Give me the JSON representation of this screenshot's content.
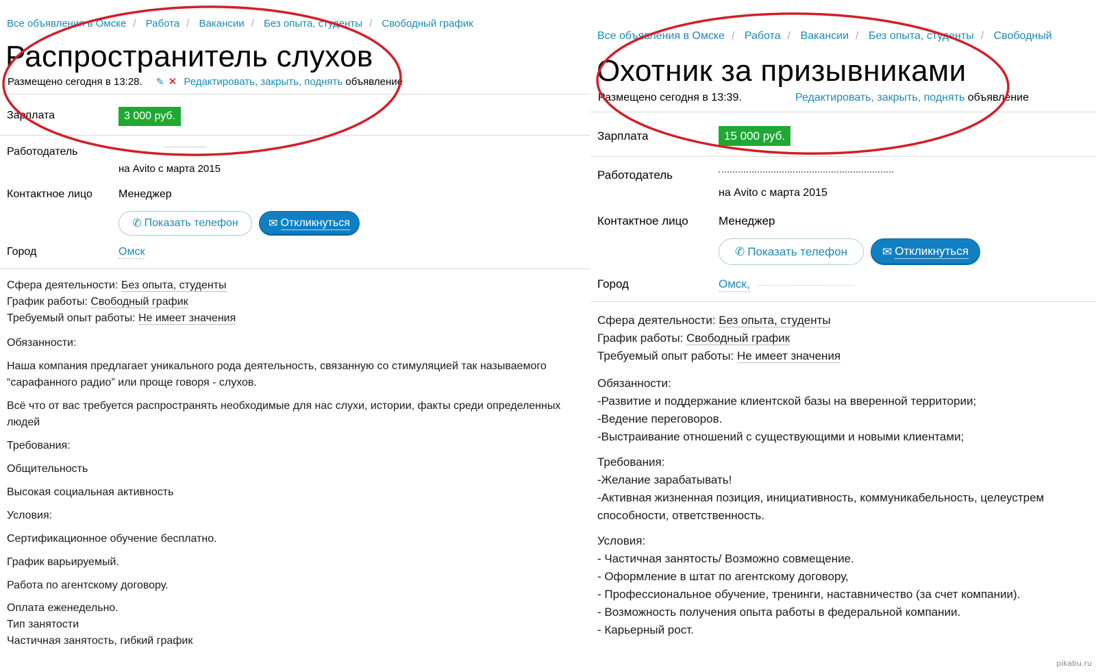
{
  "left": {
    "breadcrumbs": [
      "Все объявления в Омске",
      "Работа",
      "Вакансии",
      "Без опыта, студенты",
      "Свободный график"
    ],
    "title": "Распространитель слухов",
    "posted": "Размещено сегодня в 13:28.",
    "edit_link": "Редактировать, закрыть, поднять",
    "edit_suffix": "объявление",
    "salary_label": "Зарплата",
    "salary": "3 000 руб.",
    "employer_label": "Работодатель",
    "employer_since": "на Avito с марта 2015",
    "contact_label": "Контактное лицо",
    "contact": "Менеджер",
    "phone_button": "Показать телефон",
    "reply_button": "Откликнуться",
    "city_label": "Город",
    "city": "Омск",
    "sphere_label": "Сфера деятельности:",
    "sphere": "Без опыта, студенты",
    "schedule_label": "График работы:",
    "schedule": "Свободный график",
    "experience_label": "Требуемый опыт работы:",
    "experience": "Не имеет значения",
    "description": [
      "Обязанности:",
      "Наша компания предлагает уникального рода деятельность, связанную со стимуляцией так называемого",
      "“сарафанного радио” или проще говоря - слухов.",
      "Всё что от вас требуется распространять необходимые для нас слухи, истории, факты среди определенных",
      "людей",
      "Требования:",
      "Общительность",
      "Высокая социальная активность",
      "Условия:",
      "Сертификационное обучение бесплатно.",
      "График варьируемый.",
      "Работа по агентскому договору.",
      "Оплата еженедельно.",
      "Тип занятости",
      "Частичная занятость, гибкий график"
    ]
  },
  "right": {
    "breadcrumbs": [
      "Все объявления в Омске",
      "Работа",
      "Вакансии",
      "Без опыта, студенты",
      "Свободный"
    ],
    "title": "Охотник за призывниками",
    "posted": "Размещено сегодня в 13:39.",
    "edit_link": "Редактировать, закрыть, поднять",
    "edit_suffix": "объявление",
    "salary_label": "Зарплата",
    "salary": "15 000 руб.",
    "employer_label": "Работодатель",
    "employer_since": "на Avito с марта 2015",
    "contact_label": "Контактное лицо",
    "contact": "Менеджер",
    "phone_button": "Показать телефон",
    "reply_button": "Откликнуться",
    "city_label": "Город",
    "city": "Омск,",
    "sphere_label": "Сфера деятельности:",
    "sphere": "Без опыта, студенты",
    "schedule_label": "График работы:",
    "schedule": "Свободный график",
    "experience_label": "Требуемый опыт работы:",
    "experience": "Не имеет значения",
    "description": [
      "Обязанности:",
      "-Развитие и поддержание клиентской базы на вверенной территории;",
      "-Ведение переговоров.",
      "-Выстраивание отношений с существующими и новыми клиентами;",
      "Требования:",
      "-Желание зарабатывать!",
      "-Активная жизненная позиция, инициативность, коммуникабельность, целеустрем",
      "способности, ответственность.",
      "Условия:",
      "- Частичная занятость/ Возможно совмещение.",
      "- Оформление в штат по агентскому договору,",
      "- Профессиональное обучение, тренинги, наставничество (за счет компании).",
      "- Возможность получения опыта работы в федеральной компании.",
      "- Карьерный рост."
    ]
  },
  "watermark": "pikabu.ru",
  "colors": {
    "link": "#1b8ab3",
    "salary_bg": "#20a834",
    "reply_bg": "#117fc2",
    "oval": "#d0202a"
  },
  "icons": {
    "phone": "phone-icon",
    "mail": "envelope-icon",
    "edit": "pencil-icon",
    "delete": "cross-icon"
  }
}
